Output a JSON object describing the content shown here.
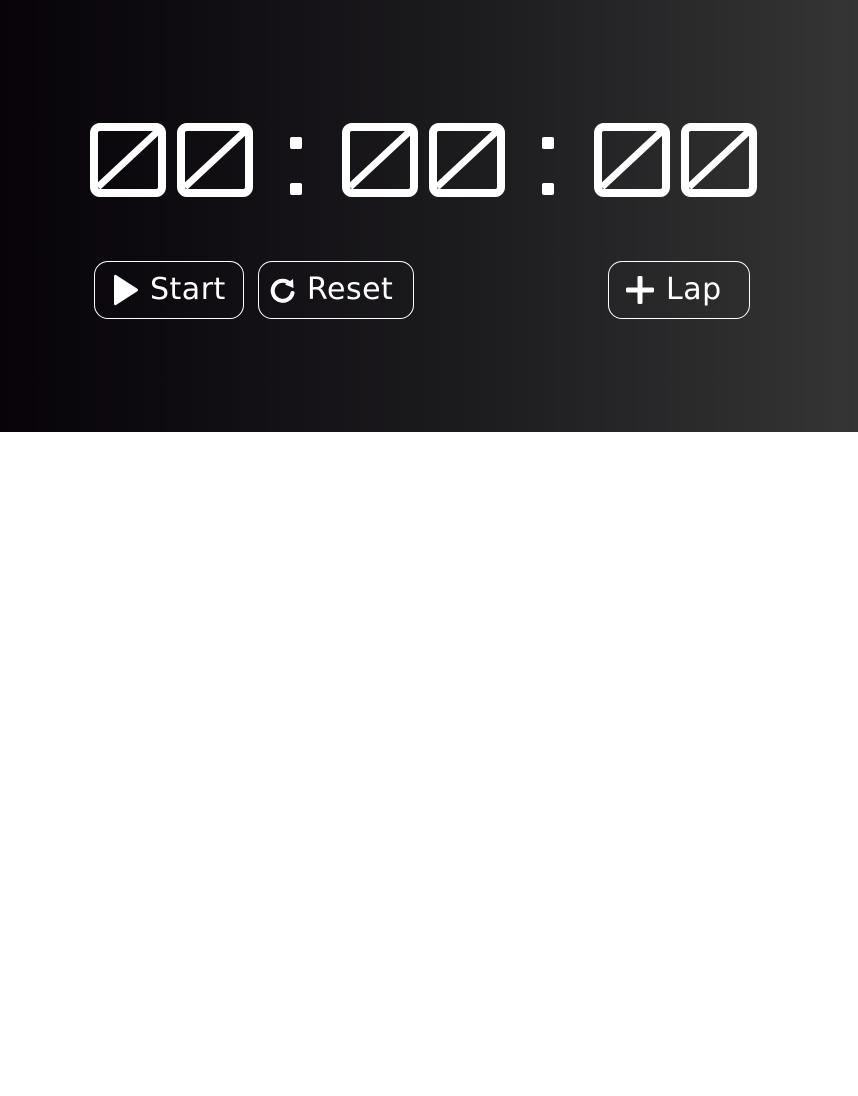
{
  "stopwatch": {
    "hours": "00",
    "minutes": "00",
    "seconds": "00",
    "separator": ":"
  },
  "controls": {
    "start_label": "Start",
    "reset_label": "Reset",
    "lap_label": "Lap",
    "start_icon": "play-icon",
    "reset_icon": "refresh-icon",
    "lap_icon": "plus-icon"
  },
  "colors": {
    "panel_gradient_start": "#070309",
    "panel_gradient_end": "#353535",
    "foreground": "#ffffff",
    "page_background": "#ffffff"
  }
}
